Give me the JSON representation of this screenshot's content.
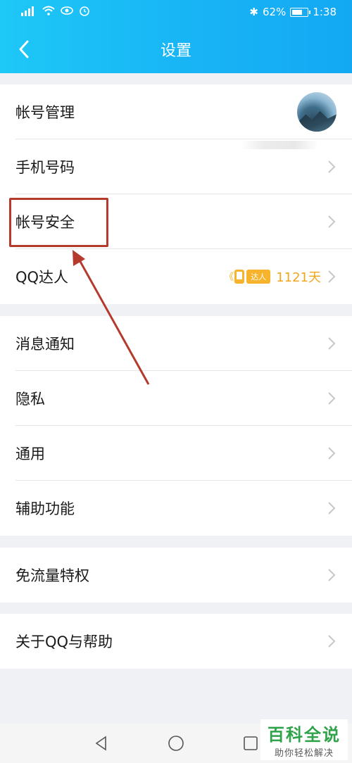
{
  "status_bar": {
    "signal_text": "⁴⁶ᴵ",
    "bluetooth": "✱",
    "battery_percent": "62%",
    "time": "1:38"
  },
  "header": {
    "title": "设置",
    "back_icon": "chevron-left-icon"
  },
  "groups": [
    {
      "rows": [
        {
          "id": "account-management",
          "label": "帐号管理"
        },
        {
          "id": "phone-number",
          "label": "手机号码"
        },
        {
          "id": "account-security",
          "label": "帐号安全"
        },
        {
          "id": "qq-talent",
          "label": "QQ达人",
          "badge": "达人",
          "days": "1121天"
        }
      ]
    },
    {
      "rows": [
        {
          "id": "notifications",
          "label": "消息通知"
        },
        {
          "id": "privacy",
          "label": "隐私"
        },
        {
          "id": "general",
          "label": "通用"
        },
        {
          "id": "accessibility",
          "label": "辅助功能"
        }
      ]
    },
    {
      "rows": [
        {
          "id": "free-data",
          "label": "免流量特权"
        }
      ]
    },
    {
      "rows": [
        {
          "id": "about-help",
          "label": "关于QQ与帮助"
        }
      ]
    }
  ],
  "watermark": {
    "title": "百科全说",
    "subtitle": "助你轻松解决"
  },
  "colors": {
    "header_gradient_start": "#1ec8f7",
    "header_gradient_end": "#14a8f3",
    "annotation_red": "#b53a2e",
    "talent_gold": "#f7b32b"
  }
}
